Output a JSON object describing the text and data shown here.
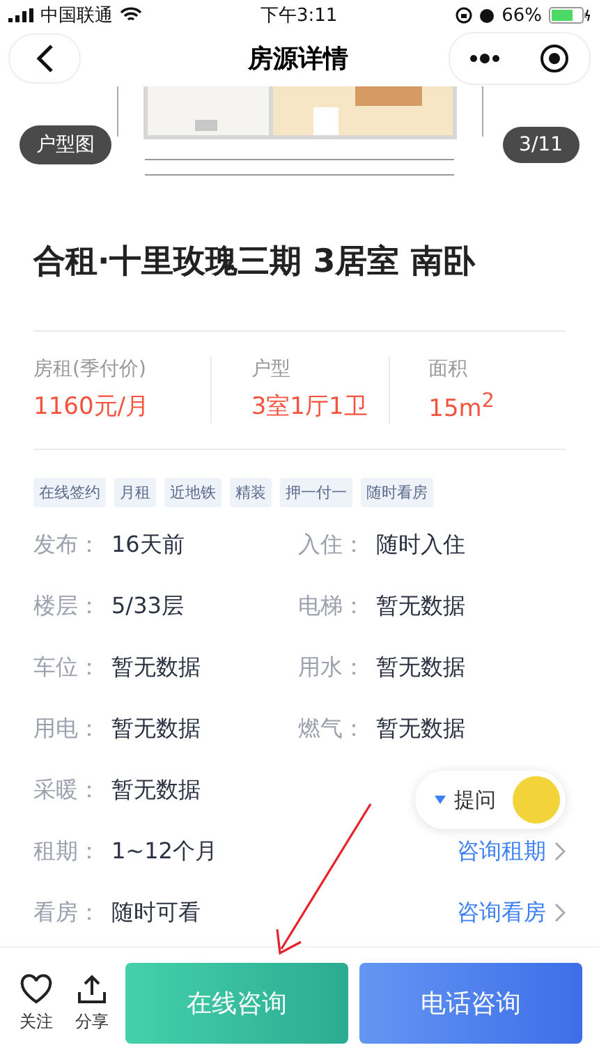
{
  "status_bar": {
    "carrier": "中国联通",
    "time": "下午3:11",
    "battery": "66%"
  },
  "nav": {
    "title": "房源详情"
  },
  "gallery": {
    "label": "户型图",
    "counter": "3/11"
  },
  "title": "合租·十里玫瑰三期 3居室 南卧",
  "stats": [
    {
      "label": "房租(季付价)",
      "value": "1160元/月"
    },
    {
      "label": "户型",
      "value": "3室1厅1卫"
    },
    {
      "label": "面积",
      "value": "15m$^{2}$"
    }
  ],
  "tags": [
    "在线签约",
    "月租",
    "近地铁",
    "精装",
    "押一付一",
    "随时看房"
  ],
  "facts": [
    {
      "label": "发布：",
      "value": "16天前"
    },
    {
      "label": "入住：",
      "value": "随时入住"
    },
    {
      "label": "楼层：",
      "value": "5/33层"
    },
    {
      "label": "电梯：",
      "value": "暂无数据"
    },
    {
      "label": "车位：",
      "value": "暂无数据"
    },
    {
      "label": "用水：",
      "value": "暂无数据"
    },
    {
      "label": "用电：",
      "value": "暂无数据"
    },
    {
      "label": "燃气：",
      "value": "暂无数据"
    },
    {
      "label": "采暖：",
      "value": "暂无数据"
    }
  ],
  "consult_rows": [
    {
      "label": "租期：",
      "value": "1~12个月",
      "action": "咨询租期"
    },
    {
      "label": "看房：",
      "value": "随时可看",
      "action": "咨询看房"
    }
  ],
  "ask_button": {
    "label": "提问"
  },
  "bottom_bar": {
    "actions": [
      {
        "kind": "heart",
        "label": "关注"
      },
      {
        "kind": "share",
        "label": "分享"
      }
    ],
    "buttons": [
      {
        "kind": "online",
        "label": "在线咨询"
      },
      {
        "kind": "phone",
        "label": "电话咨询"
      }
    ]
  }
}
